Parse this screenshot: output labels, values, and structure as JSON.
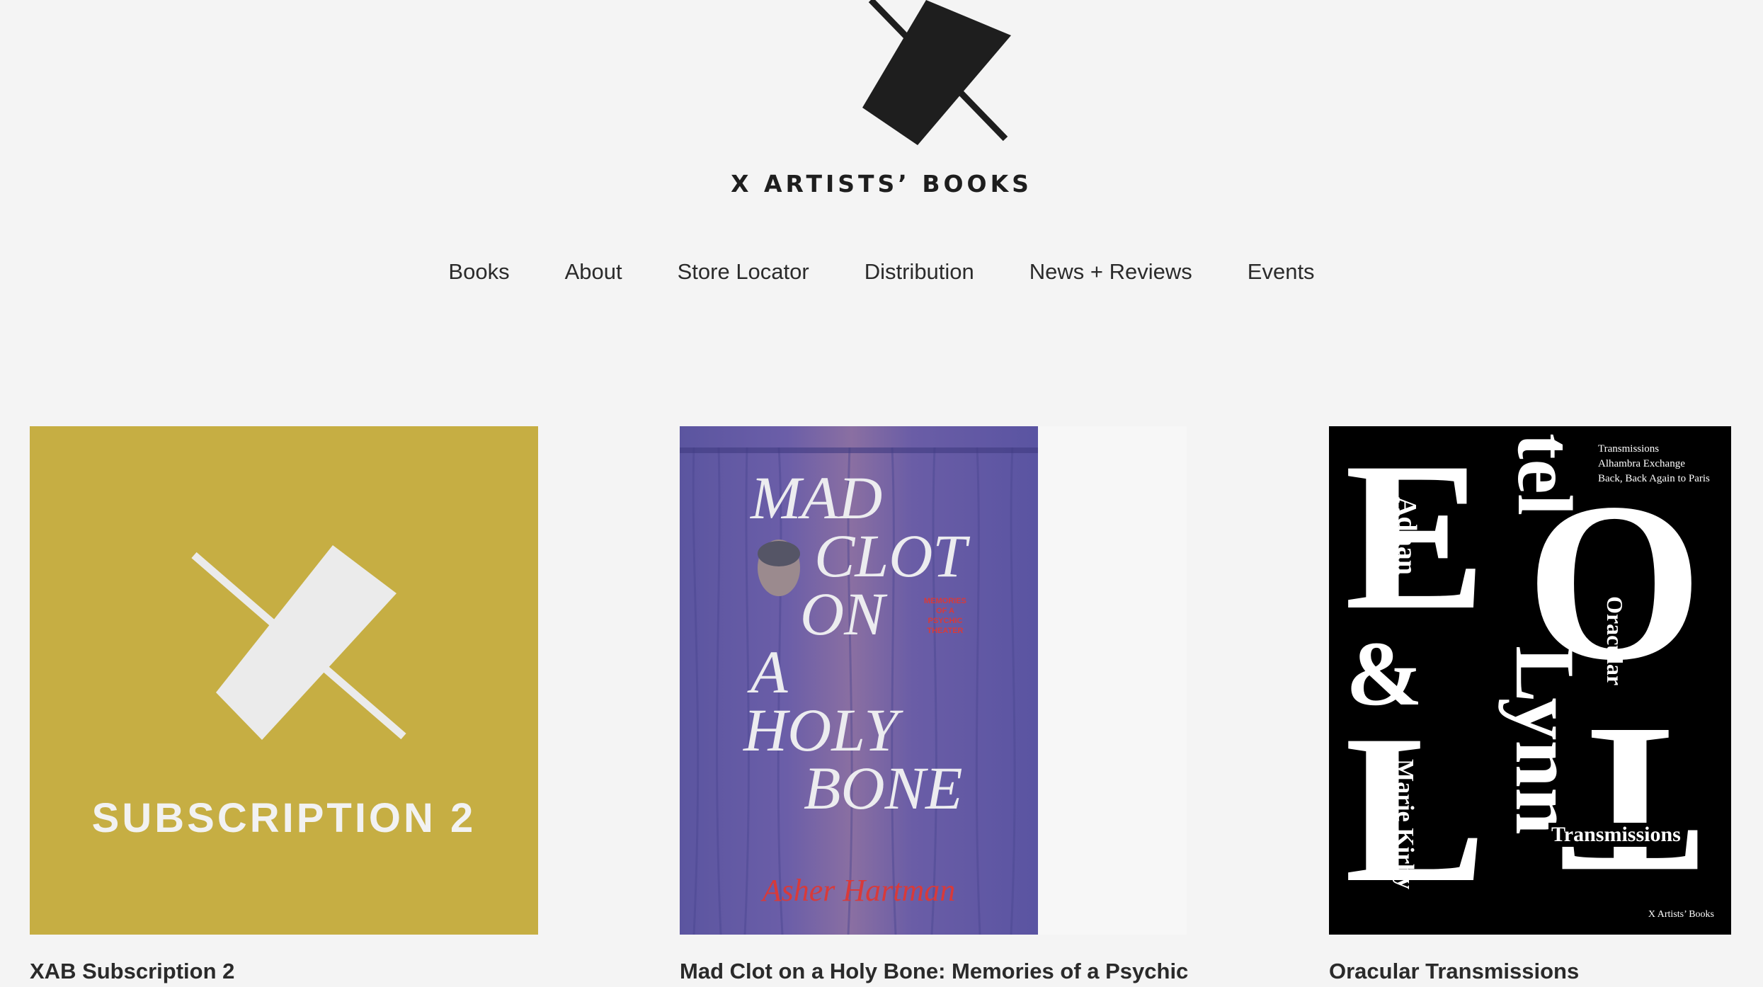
{
  "brand": {
    "name": "X ARTISTS’ BOOKS",
    "logo_icon": "x-logo-icon"
  },
  "nav": {
    "items": [
      "Books",
      "About",
      "Store Locator",
      "Distribution",
      "News + Reviews",
      "Events"
    ]
  },
  "products": [
    {
      "title": "XAB Subscription 2",
      "cover": {
        "label": "SUBSCRIPTION  2",
        "bg": "#c6ae43"
      }
    },
    {
      "title": "Mad Clot on a Holy Bone: Memories of a Psychic",
      "cover": {
        "title_lines": [
          "MAD",
          "CLOT",
          "ON",
          "A",
          "HOLY",
          "BONE"
        ],
        "subtitle_lines": [
          "MEMORIES",
          "OF A",
          "PSYCHIC",
          "THEATER"
        ],
        "author": "Asher Hartman"
      }
    },
    {
      "title": "Oracular Transmissions",
      "cover": {
        "top_lines": [
          "Transmissions",
          "Alhambra Exchange",
          "Back, Back Again to Paris"
        ],
        "author1": "Adnan",
        "author2": "Marie Kirby",
        "vertical_word": "Oracular",
        "name_word": "Lynn",
        "big_letters": [
          "E",
          "L",
          "tel",
          "O",
          "T"
        ],
        "ampersand": "&",
        "bottom_word": "Transmissions",
        "publisher": "X Artists’ Books"
      }
    }
  ],
  "colors": {
    "background": "#f4f4f4",
    "text": "#2a2a2a",
    "subscription": "#c6ae43",
    "oracular_cover": "#000000"
  }
}
